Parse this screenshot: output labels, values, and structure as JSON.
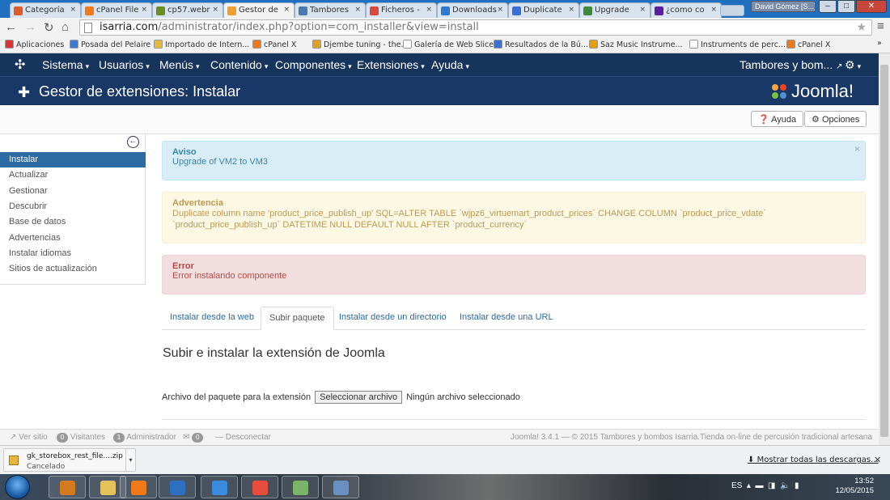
{
  "browser": {
    "tabs": [
      {
        "label": "Categoría",
        "color": "#e05a2b"
      },
      {
        "label": "cPanel File",
        "color": "#f07a1a"
      },
      {
        "label": "cp57.webr",
        "color": "#6b8e23"
      },
      {
        "label": "Gestor de",
        "color": "#f0a030"
      },
      {
        "label": "Tambores",
        "color": "#4a7ab0"
      },
      {
        "label": "Ficheros -",
        "color": "#d94a3a"
      },
      {
        "label": "Downloads",
        "color": "#2d7bd0"
      },
      {
        "label": "Duplicate",
        "color": "#3a6fd8"
      },
      {
        "label": "Upgrade",
        "color": "#3d8a3d"
      },
      {
        "label": "¿como co",
        "color": "#5a1fa0"
      }
    ],
    "user_chip": "David Gómez [S...]",
    "url_host": "isarria.com",
    "url_path": "/administrator/index.php?option=com_installer&view=install",
    "bookmarks": [
      "Aplicaciones",
      "Posada del Pelaire",
      "Importado de Intern...",
      "cPanel X",
      "Djembe tuning - the...",
      "Galería de Web Slice",
      "Resultados de la Bú...",
      "Saz Music Instrume...",
      "Instruments de perc...",
      "cPanel X"
    ],
    "overflow": "»"
  },
  "topnav": {
    "items": [
      "Sistema",
      "Usuarios",
      "Menús",
      "Contenido",
      "Componentes",
      "Extensiones",
      "Ayuda"
    ],
    "site_link": "Tambores y bom..."
  },
  "header": {
    "title": "Gestor de extensiones: Instalar",
    "logo_text": "Joomla!"
  },
  "toolbar": {
    "help": "Ayuda",
    "options": "Opciones"
  },
  "sidebar": {
    "items": [
      "Instalar",
      "Actualizar",
      "Gestionar",
      "Descubrir",
      "Base de datos",
      "Advertencias",
      "Instalar idiomas",
      "Sitios de actualización"
    ],
    "active_index": 0
  },
  "alerts": {
    "info": {
      "heading": "Aviso",
      "text": "Upgrade of VM2 to VM3"
    },
    "warning": {
      "heading": "Advertencia",
      "text": "Duplicate column name 'product_price_publish_up' SQL=ALTER TABLE `wjpz6_virtuemart_product_prices` CHANGE COLUMN `product_price_vdate` `product_price_publish_up` DATETIME NULL DEFAULT NULL AFTER `product_currency`"
    },
    "error": {
      "heading": "Error",
      "text": "Error instalando componente"
    }
  },
  "install_tabs": [
    "Instalar desde la web",
    "Subir paquete",
    "Instalar desde un directorio",
    "Instalar desde una URL"
  ],
  "active_tab": 1,
  "section_title": "Subir e instalar la extensión de Joomla",
  "upload": {
    "label": "Archivo del paquete para la extensión",
    "button": "Seleccionar archivo",
    "status": "Ningún archivo seleccionado"
  },
  "status_bar": {
    "view_site": "Ver sitio",
    "visitors_count": "0",
    "visitors_label": "Visitantes",
    "admin_count": "1",
    "admin_label": "Administrador",
    "messages_count": "0",
    "logout": "Desconectar",
    "footer": "Joomla! 3.4.1 — © 2015 Tambores y bombos Isarria.Tienda on-line de percusión tradicional artesana"
  },
  "downloads": {
    "file_name": "gk_storebox_rest_file....zip",
    "file_status": "Cancelado",
    "show_all": "Mostrar todas las descargas..."
  },
  "taskbar": {
    "language": "ES",
    "time": "13:52",
    "date": "12/05/2015"
  }
}
